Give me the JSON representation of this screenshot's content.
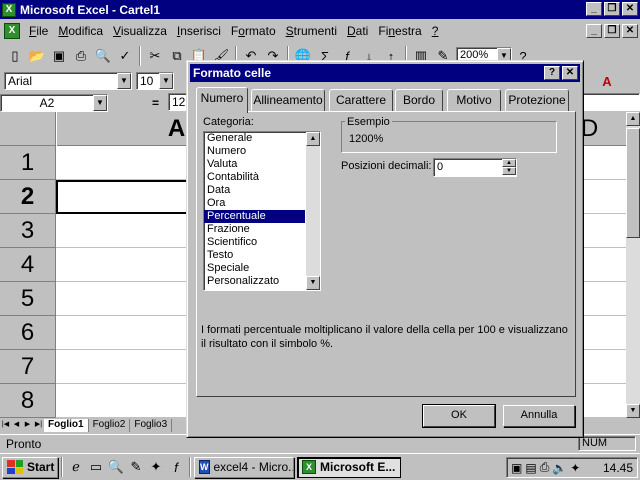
{
  "window": {
    "title": "Microsoft Excel - Cartel1",
    "app_icon": "X"
  },
  "window_controls": [
    "_",
    "❐",
    "✕"
  ],
  "menu": [
    "File",
    "Modifica",
    "Visualizza",
    "Inserisci",
    "Formato",
    "Strumenti",
    "Dati",
    "Finestra",
    "?"
  ],
  "menu_underline": [
    "F",
    "M",
    "V",
    "I",
    "o",
    "S",
    "D",
    "n",
    "?"
  ],
  "doc_controls": [
    "_",
    "❐",
    "✕"
  ],
  "toolbar": {
    "zoom": "200%"
  },
  "format_toolbar": {
    "font": "Arial",
    "size": "10"
  },
  "formula_bar": {
    "cell_ref": "A2",
    "equals": "=",
    "content": "12"
  },
  "grid": {
    "columns": [
      "A",
      "D"
    ],
    "rows": [
      "1",
      "2",
      "3",
      "4",
      "5",
      "6",
      "7",
      "8"
    ],
    "active_row": "2"
  },
  "sheets": [
    "Foglio1",
    "Foglio2",
    "Foglio3"
  ],
  "status": {
    "text": "Pronto",
    "num": "NUM"
  },
  "taskbar": {
    "start": "Start",
    "tasks": [
      {
        "label": "excel4 - Micro...",
        "icon": "W"
      },
      {
        "label": "Microsoft E...",
        "icon": "X"
      }
    ],
    "clock": "14.45"
  },
  "dialog": {
    "title": "Formato celle",
    "help": "?",
    "close": "✕",
    "tabs": [
      "Numero",
      "Allineamento",
      "Carattere",
      "Bordo",
      "Motivo",
      "Protezione"
    ],
    "active_tab": 0,
    "category_label": "Categoria:",
    "categories": [
      "Generale",
      "Numero",
      "Valuta",
      "Contabilità",
      "Data",
      "Ora",
      "Percentuale",
      "Frazione",
      "Scientifico",
      "Testo",
      "Speciale",
      "Personalizzato"
    ],
    "selected_category": "Percentuale",
    "example_label": "Esempio",
    "example_value": "1200%",
    "decimals_label": "Posizioni decimali:",
    "decimals_value": "0",
    "description": "I formati percentuale moltiplicano il valore della cella per 100 e visualizzano il risultato con il simbolo %.",
    "ok": "OK",
    "cancel": "Annulla"
  }
}
